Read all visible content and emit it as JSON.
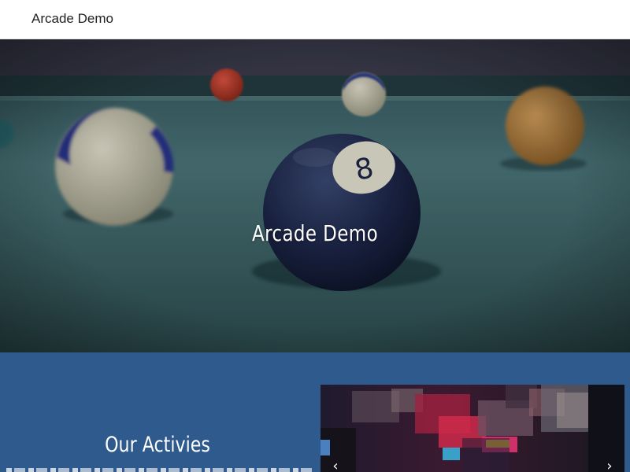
{
  "header": {
    "site_title": "Arcade Demo"
  },
  "hero": {
    "title": "Arcade Demo",
    "image": "pool-table-eight-ball-photo"
  },
  "activities": {
    "title": "Our Activies",
    "carousel_image": "arcade-room-photo",
    "prev_icon": "chevron-left-icon",
    "next_icon": "chevron-right-icon",
    "prev_glyph": "‹",
    "next_glyph": "›"
  },
  "colors": {
    "section_bg": "#2e5a8e",
    "header_bg": "#ffffff"
  }
}
